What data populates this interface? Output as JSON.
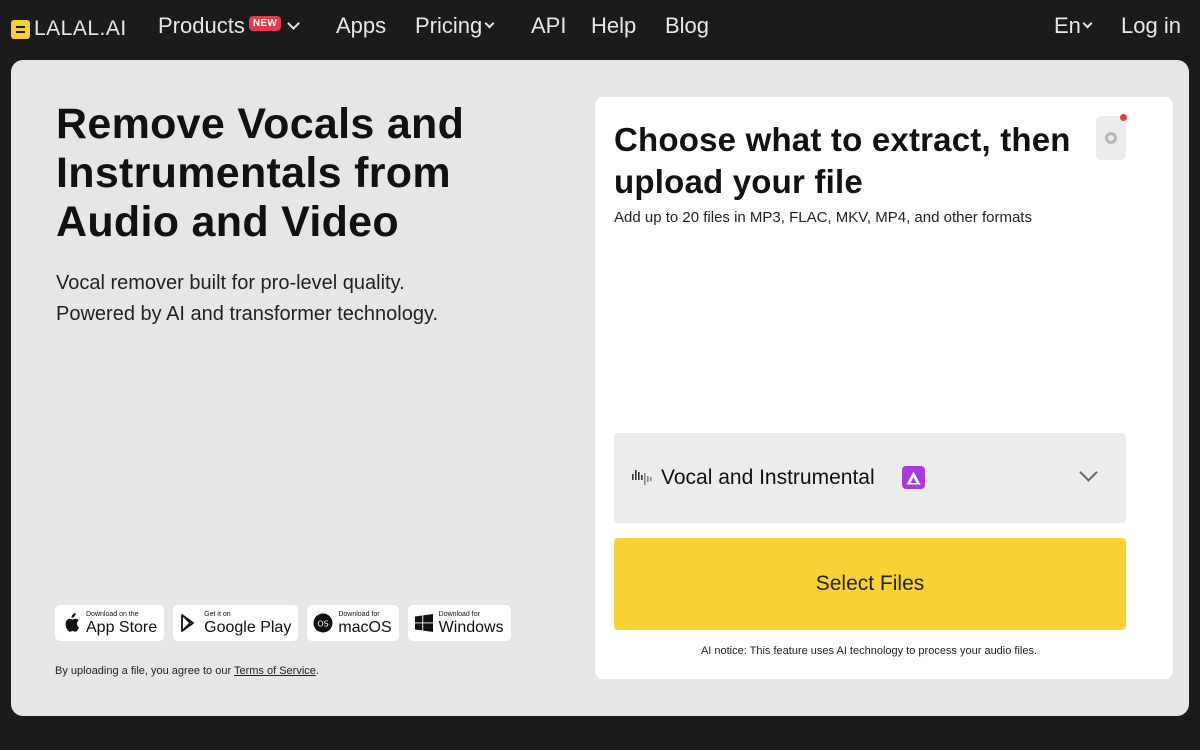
{
  "brand": {
    "name": "LALAL.AI",
    "accent": "#f5d033"
  },
  "nav": {
    "products": "Products",
    "products_badge": "NEW",
    "apps": "Apps",
    "pricing": "Pricing",
    "api": "API",
    "help": "Help",
    "blog": "Blog",
    "language": "En",
    "login": "Log in"
  },
  "hero": {
    "title": "Remove Vocals and Instrumentals from Audio and Video",
    "subtitle_line1": "Vocal remover built for pro-level quality.",
    "subtitle_line2": "Powered by AI and transformer technology."
  },
  "stores": [
    {
      "small": "Download on the",
      "big": "App Store",
      "icon": "apple-icon"
    },
    {
      "small": "Get it on",
      "big": "Google Play",
      "icon": "google-play-icon"
    },
    {
      "small": "Download for",
      "big": "macOS",
      "icon": "macos-icon"
    },
    {
      "small": "Download for",
      "big": "Windows",
      "icon": "windows-icon"
    }
  ],
  "terms": {
    "prefix": "By uploading a file, you agree to our ",
    "link": "Terms of Service",
    "suffix": "."
  },
  "panel": {
    "title": "Choose what to extract, then upload your file",
    "subtitle": "Add up to 20 files in MP3, FLAC, MKV, MP4, and other formats",
    "stem_selected": "Vocal and Instrumental",
    "select_button": "Select Files",
    "ai_notice": "AI notice: This feature uses AI technology to process your audio files."
  },
  "colors": {
    "background": "#1b1b1d",
    "card": "#e6e6e6",
    "button": "#f6d232",
    "badge_new": "#e8394b",
    "ai_badge": "#a63bdc"
  }
}
